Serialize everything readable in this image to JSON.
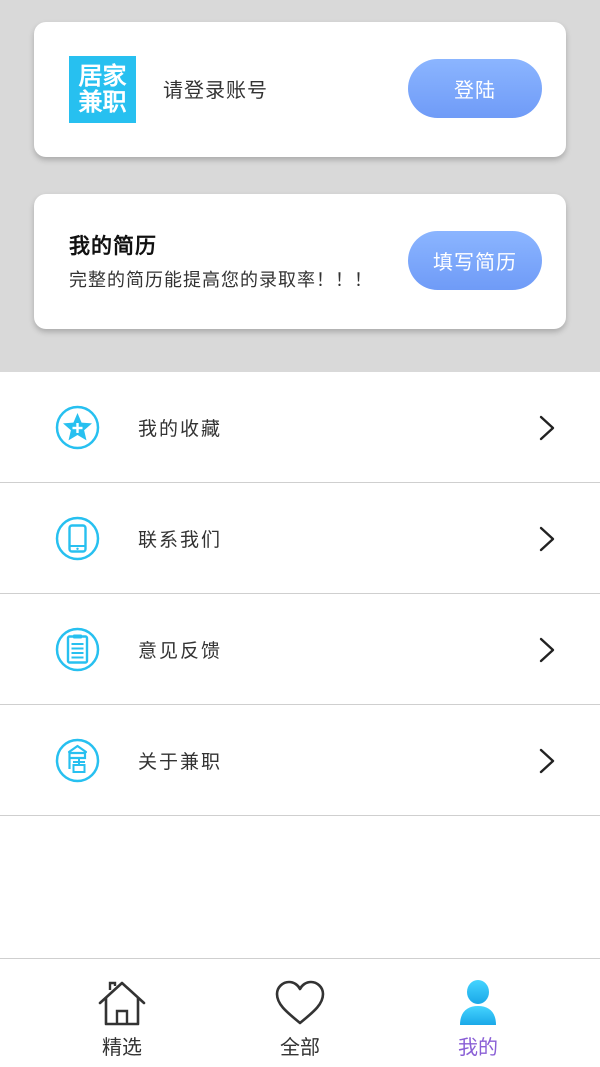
{
  "login_card": {
    "logo_top": "居家",
    "logo_bottom": "兼职",
    "prompt": "请登录账号",
    "login_button": "登陆"
  },
  "resume_card": {
    "title": "我的简历",
    "subtitle": "完整的简历能提高您的录取率！！！",
    "fill_button": "填写简历"
  },
  "menu": {
    "items": [
      {
        "label": "我的收藏",
        "icon": "star-plus-icon"
      },
      {
        "label": "联系我们",
        "icon": "phone-icon"
      },
      {
        "label": "意见反馈",
        "icon": "clipboard-icon"
      },
      {
        "label": "关于兼职",
        "icon": "house-ju-icon"
      }
    ]
  },
  "tabbar": {
    "tabs": [
      {
        "label": "精选",
        "icon": "home-icon"
      },
      {
        "label": "全部",
        "icon": "heart-icon"
      },
      {
        "label": "我的",
        "icon": "user-icon"
      }
    ],
    "active_color": "#8a5fd6"
  },
  "colors": {
    "accent": "#27c0f0",
    "button": "#7aa6fb"
  }
}
